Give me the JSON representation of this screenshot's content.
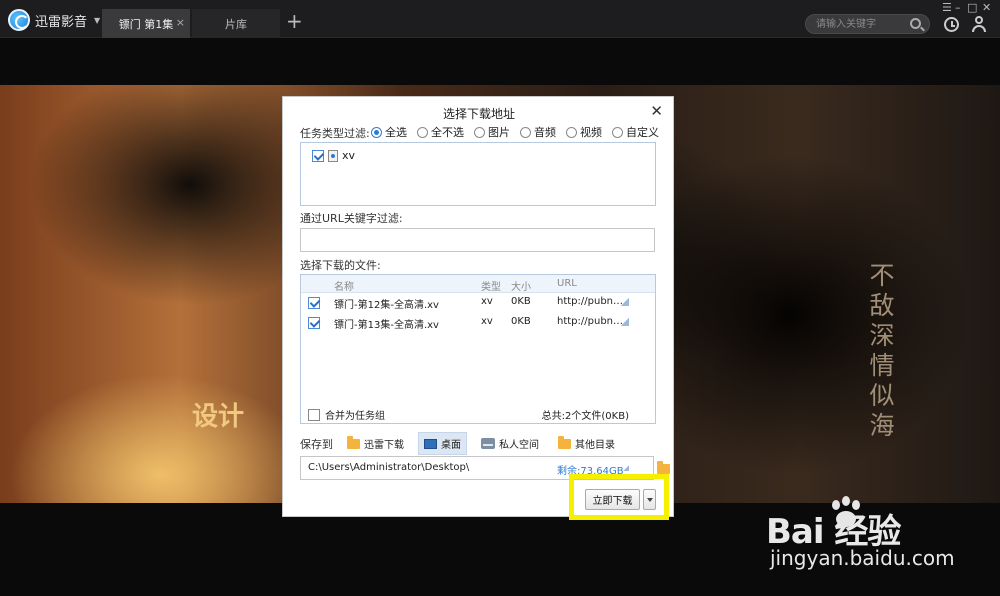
{
  "app": {
    "name": "迅雷影音"
  },
  "tabs": [
    {
      "label": "镖门 第1集",
      "close": "×"
    },
    {
      "label": "片库"
    }
  ],
  "tab_add": "+",
  "search": {
    "placeholder": "请输入关键字"
  },
  "window_controls": {
    "menu": "☰",
    "minimize": "–",
    "maximize": "□",
    "close": "✕"
  },
  "video": {
    "poem": [
      "不",
      "敌",
      "深",
      "情",
      "似",
      "海"
    ],
    "overlay_text": "设计"
  },
  "dialog": {
    "title": "选择下载地址",
    "close": "✕",
    "type_filter_label": "任务类型过滤:",
    "type_options": [
      {
        "label": "全选",
        "selected": true
      },
      {
        "label": "全不选",
        "selected": false
      },
      {
        "label": "图片",
        "selected": false
      },
      {
        "label": "音频",
        "selected": false
      },
      {
        "label": "视频",
        "selected": false
      },
      {
        "label": "自定义",
        "selected": false
      }
    ],
    "type_items": [
      {
        "label": "xv",
        "checked": true
      }
    ],
    "url_filter_label": "通过URL关键字过滤:",
    "url_filter_value": "",
    "files_label": "选择下载的文件:",
    "columns": [
      "名称",
      "类型",
      "大小",
      "URL"
    ],
    "files": [
      {
        "name": "镖门-第12集-全高清.xv",
        "type": "xv",
        "size": "0KB",
        "url": "http://pubn…",
        "checked": true
      },
      {
        "name": "镖门-第13集-全高清.xv",
        "type": "xv",
        "size": "0KB",
        "url": "http://pubn…",
        "checked": true
      }
    ],
    "merge_label": "合并为任务组",
    "total": "总共:2个文件(0KB)",
    "save_to_label": "保存到",
    "locations": [
      {
        "label": "迅雷下载",
        "icon": "folder-icon",
        "active": false
      },
      {
        "label": "桌面",
        "icon": "desktop-icon",
        "active": true
      },
      {
        "label": "私人空间",
        "icon": "nas-icon",
        "active": false
      },
      {
        "label": "其他目录",
        "icon": "folder-icon",
        "active": false
      }
    ],
    "path": "C:\\Users\\Administrator\\Desktop\\",
    "free_space": "剩余:73.64GB",
    "download_button": "立即下载"
  },
  "watermark": {
    "brand": "Bai  经验",
    "url": "jingyan.baidu.com"
  },
  "colors": {
    "accent": "#2d7ad6",
    "highlight": "#f4f000"
  }
}
